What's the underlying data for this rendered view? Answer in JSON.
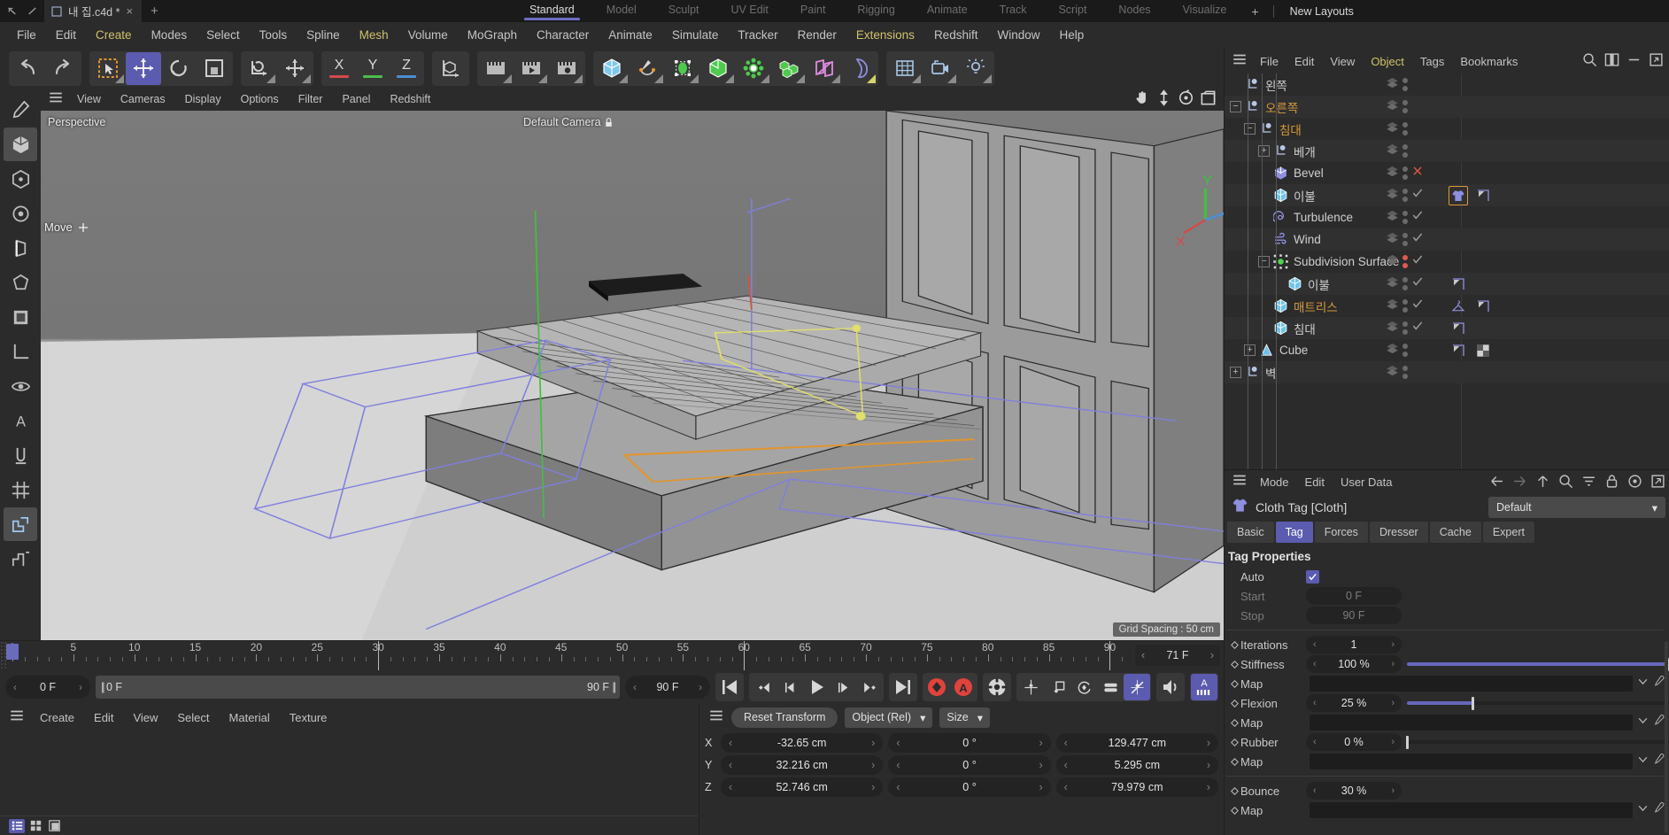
{
  "titlebar": {
    "document_tab": "내 집.c4d *",
    "close_label": "×",
    "new_tab_label": "+",
    "layouts": [
      "Standard",
      "Model",
      "Sculpt",
      "UV Edit",
      "Paint",
      "Rigging",
      "Animate",
      "Track",
      "Script",
      "Nodes",
      "Visualize"
    ],
    "active_layout": "Standard",
    "add_layout_label": "+",
    "new_layouts_label": "New Layouts"
  },
  "menubar": {
    "items": [
      "File",
      "Edit",
      "Create",
      "Modes",
      "Select",
      "Tools",
      "Spline",
      "Mesh",
      "Volume",
      "MoGraph",
      "Character",
      "Animate",
      "Simulate",
      "Tracker",
      "Render",
      "Extensions",
      "Redshift",
      "Window",
      "Help"
    ],
    "highlighted": [
      "Create",
      "Mesh",
      "Extensions"
    ]
  },
  "toolbar": {
    "undo": "undo-icon",
    "redo": "redo-icon",
    "live_selection": "live-selection-icon",
    "move": "move-tool-icon",
    "rotate": "rotate-tool-icon",
    "scale": "scale-tool-icon",
    "world_axis": "world-axis-icon",
    "enable_axis": "enable-axis-icon",
    "axes": [
      "X",
      "Y",
      "Z"
    ],
    "axis_colors": [
      "#d24b4b",
      "#4bbf4b",
      "#4b8fd2"
    ],
    "object_axis": "object-axis-icon",
    "render_view": "render-view-icon",
    "render_queue": "render-queue-icon",
    "render_settings": "render-settings-icon",
    "cube": "cube-primitive-icon",
    "spline": "spline-pen-icon",
    "generator": "generator-icon",
    "bend": "bend-deformer-icon",
    "scene": "scene-icon",
    "mograph": "mograph-icon",
    "field": "field-icon",
    "character": "character-icon",
    "floor": "floor-icon",
    "camera": "camera-icon",
    "light": "light-icon"
  },
  "leftbar": {
    "items": [
      "paint-icon",
      "model-mode-icon",
      "object-mode-icon",
      "point-mode-icon",
      "edge-mode-icon",
      "polygon-mode-icon",
      "texture-mode-icon",
      "workplane-icon",
      "viewport-solo-icon",
      "axis-mode-icon",
      "uv-points-icon",
      "grid-snap-icon",
      "snap-icon",
      "quantize-icon"
    ]
  },
  "viewport": {
    "menu": [
      "View",
      "Cameras",
      "Display",
      "Options",
      "Filter",
      "Panel",
      "Redshift"
    ],
    "perspective_label": "Perspective",
    "camera_label": "Default Camera",
    "tool_label": "Move",
    "grid_spacing": "Grid Spacing : 50 cm",
    "nav_icons": [
      "hand-pan-icon",
      "dolly-icon",
      "orbit-icon",
      "maximize-viewport-icon"
    ],
    "axis_labels": {
      "x": "X",
      "y": "Y",
      "z": "Z"
    }
  },
  "timeline": {
    "ticks": [
      0,
      5,
      10,
      15,
      20,
      25,
      30,
      35,
      40,
      45,
      50,
      55,
      60,
      65,
      70,
      75,
      80,
      85,
      90
    ],
    "min": 0,
    "max": 92,
    "playhead_frame": 0,
    "current_frame_field": "71 F"
  },
  "animbar": {
    "current_frame": "0 F",
    "range_start": "0 F",
    "range_end": "90 F",
    "preview_end": "90 F",
    "buttons": [
      "go-to-start-icon",
      "prev-key-icon",
      "prev-frame-icon",
      "play-icon",
      "next-frame-icon",
      "next-key-icon",
      "go-to-end-icon",
      "record-keyframe-icon",
      "autokey-icon",
      "keyframe-settings-icon",
      "position-key-icon",
      "scale-key-icon",
      "rotation-key-icon",
      "param-key-icon",
      "pla-key-icon",
      "sound-icon",
      "animation-layer-icon"
    ]
  },
  "material_manager": {
    "menu": [
      "Create",
      "Edit",
      "View",
      "Select",
      "Material",
      "Texture"
    ],
    "view_modes": [
      "list-view-icon",
      "icon-view-icon",
      "preview-view-icon"
    ],
    "active_view_mode": "list-view-icon"
  },
  "coordinates": {
    "reset_label": "Reset Transform",
    "mode": "Object (Rel)",
    "size_mode": "Size",
    "rows": [
      {
        "axis": "X",
        "position": "-32.65 cm",
        "rotation": "0 °",
        "size": "129.477 cm"
      },
      {
        "axis": "Y",
        "position": "32.216 cm",
        "rotation": "0 °",
        "size": "5.295 cm"
      },
      {
        "axis": "Z",
        "position": "52.746 cm",
        "rotation": "0 °",
        "size": "79.979 cm"
      }
    ]
  },
  "object_manager": {
    "menu": [
      "File",
      "Edit",
      "View",
      "Object",
      "Tags",
      "Bookmarks"
    ],
    "highlighted": [
      "Object"
    ],
    "header_icons": [
      "search-icon",
      "layout-columns-icon",
      "minimize-icon",
      "expand-icon"
    ],
    "rows": [
      {
        "label": "왼쪽",
        "icon": "null-object-icon",
        "depth": 1,
        "twirl": "none",
        "selected": false,
        "vis": "none",
        "tags": []
      },
      {
        "label": "오른쪽",
        "icon": "null-object-icon",
        "depth": 1,
        "twirl": "minus",
        "selected": true,
        "vis": "none",
        "tags": []
      },
      {
        "label": "침대",
        "icon": "null-object-icon",
        "depth": 2,
        "twirl": "minus",
        "selected": true,
        "vis": "none",
        "tags": []
      },
      {
        "label": "베개",
        "icon": "null-object-icon",
        "depth": 3,
        "twirl": "plus",
        "selected": false,
        "vis": "none",
        "tags": []
      },
      {
        "label": "Bevel",
        "icon": "bevel-deformer-icon",
        "depth": 3,
        "twirl": "none",
        "selected": false,
        "vis": "x",
        "tags": []
      },
      {
        "label": "이불",
        "icon": "polygon-object-icon",
        "depth": 3,
        "twirl": "none",
        "selected": false,
        "vis": "check",
        "tags": [
          "cloth-tag-icon",
          "phong-tag-icon"
        ],
        "tag_selected": 0
      },
      {
        "label": "Turbulence",
        "icon": "turbulence-icon",
        "depth": 3,
        "twirl": "none",
        "selected": false,
        "vis": "check",
        "tags": []
      },
      {
        "label": "Wind",
        "icon": "wind-icon",
        "depth": 3,
        "twirl": "none",
        "selected": false,
        "vis": "check",
        "tags": []
      },
      {
        "label": "Subdivision Surface",
        "icon": "subdivision-surface-icon",
        "depth": 3,
        "twirl": "minus",
        "selected": false,
        "vis": "check",
        "dots": "red",
        "tags": []
      },
      {
        "label": "이불",
        "icon": "polygon-object-icon",
        "depth": 4,
        "twirl": "none",
        "selected": false,
        "vis": "check",
        "tags": [
          "phong-tag-icon"
        ]
      },
      {
        "label": "매트리스",
        "icon": "polygon-object-icon",
        "depth": 3,
        "twirl": "none",
        "selected": true,
        "vis": "check",
        "tags": [
          "cloth-belt-tag-icon",
          "phong-tag-icon"
        ]
      },
      {
        "label": "침대",
        "icon": "polygon-object-icon",
        "depth": 3,
        "twirl": "none",
        "selected": false,
        "vis": "check",
        "tags": [
          "phong-tag-icon"
        ]
      },
      {
        "label": "Cube",
        "icon": "cone-object-icon",
        "depth": 2,
        "twirl": "plus",
        "selected": false,
        "vis": "none",
        "tags": [
          "phong-tag-icon",
          "texture-tag-icon"
        ]
      },
      {
        "label": "벽",
        "icon": "null-object-icon",
        "depth": 1,
        "twirl": "plus",
        "selected": false,
        "vis": "none",
        "tags": []
      }
    ]
  },
  "attribute_manager": {
    "menu": [
      "Mode",
      "Edit",
      "User Data"
    ],
    "header_icons": [
      "back-arrow-icon",
      "forward-arrow-icon",
      "up-arrow-icon",
      "search-icon",
      "filter-icon",
      "lock-icon",
      "target-icon",
      "popout-icon"
    ],
    "title": "Cloth Tag [Cloth]",
    "title_icon": "cloth-tag-icon",
    "preset": "Default",
    "tabs": [
      "Basic",
      "Tag",
      "Forces",
      "Dresser",
      "Cache",
      "Expert"
    ],
    "active_tab": "Tag",
    "section": "Tag Properties",
    "properties": [
      {
        "label": "Auto",
        "type": "checkbox",
        "value": true
      },
      {
        "label": "Start",
        "type": "field",
        "value": "0 F",
        "disabled": true
      },
      {
        "label": "Stop",
        "type": "field",
        "value": "90 F",
        "disabled": true
      },
      {
        "separator": true
      },
      {
        "label": "Iterations",
        "type": "spinner",
        "value": "1"
      },
      {
        "label": "Stiffness",
        "type": "slider",
        "value": "100 %",
        "percent": 100
      },
      {
        "label": "Map",
        "type": "map",
        "value": ""
      },
      {
        "label": "Flexion",
        "type": "slider",
        "value": "25 %",
        "percent": 25
      },
      {
        "label": "Map",
        "type": "map",
        "value": ""
      },
      {
        "label": "Rubber",
        "type": "slider",
        "value": "0 %",
        "percent": 0
      },
      {
        "label": "Map",
        "type": "map",
        "value": ""
      },
      {
        "separator": true
      },
      {
        "label": "Bounce",
        "type": "spinner",
        "value": "30 %"
      },
      {
        "label": "Map",
        "type": "map",
        "value": ""
      }
    ],
    "accent_color": "#6767bd"
  }
}
